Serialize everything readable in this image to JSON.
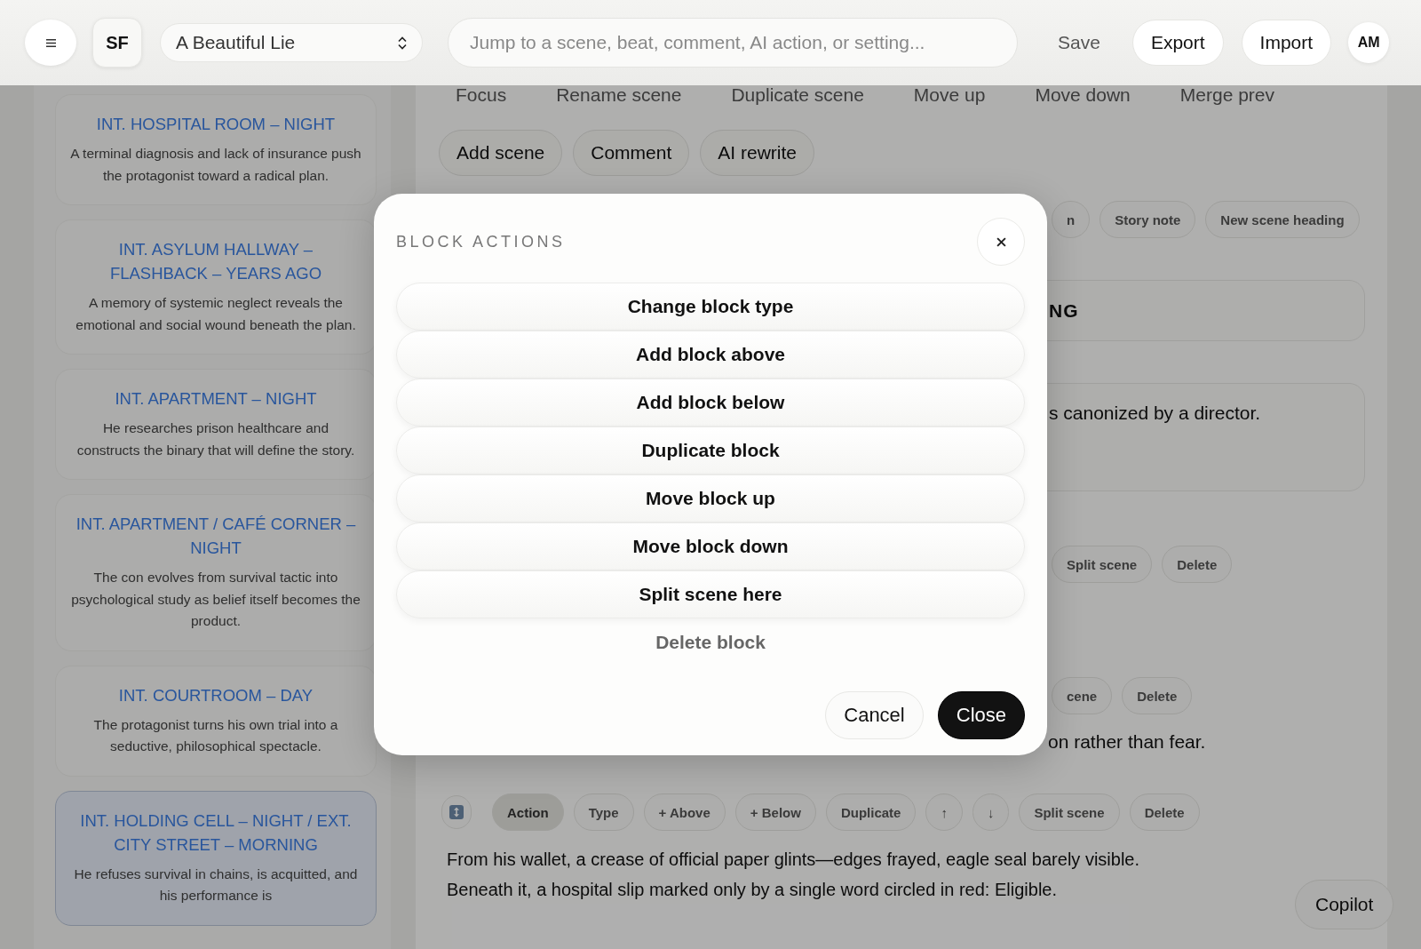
{
  "topbar": {
    "logo": "SF",
    "project": {
      "value": "A Beautiful Lie"
    },
    "search": {
      "placeholder": "Jump to a scene, beat, comment, AI action, or setting..."
    },
    "buttons": [
      {
        "label": "Save",
        "kind": "text"
      },
      {
        "label": "Export",
        "kind": "pill"
      },
      {
        "label": "Import",
        "kind": "pill"
      }
    ],
    "avatar": "AM"
  },
  "sidebar": {
    "scenes": [
      {
        "heading": "INT. HOSPITAL ROOM – NIGHT",
        "summary": "A terminal diagnosis and lack of insurance push the protagonist toward a radical plan.",
        "selected": false
      },
      {
        "heading": "INT. ASYLUM HALLWAY – FLASHBACK – YEARS AGO",
        "summary": "A memory of systemic neglect reveals the emotional and social wound beneath the plan.",
        "selected": false
      },
      {
        "heading": "INT. APARTMENT – NIGHT",
        "summary": "He researches prison healthcare and constructs the binary that will define the story.",
        "selected": false
      },
      {
        "heading": "INT. APARTMENT / CAFÉ CORNER – NIGHT",
        "summary": "The con evolves from survival tactic into psychological study as belief itself becomes the product.",
        "selected": false
      },
      {
        "heading": "INT. COURTROOM – DAY",
        "summary": "The protagonist turns his own trial into a seductive, philosophical spectacle.",
        "selected": false
      },
      {
        "heading": "INT. HOLDING CELL – NIGHT / EXT. CITY STREET – MORNING",
        "summary": "He refuses survival in chains, is acquitted, and his performance is",
        "selected": true
      }
    ]
  },
  "editor": {
    "scene_actions": [
      "Focus",
      "Rename scene",
      "Duplicate scene",
      "Move up",
      "Move down",
      "Merge prev"
    ],
    "scene_buttons": [
      "Add scene",
      "Comment",
      "AI rewrite"
    ],
    "blocks": [
      {
        "kind": "chips",
        "items": [
          {
            "label": "n",
            "selected": false
          },
          {
            "label": "Story note",
            "selected": false
          },
          {
            "label": "New scene heading",
            "selected": false
          }
        ]
      },
      {
        "kind": "heading",
        "text": "NG"
      },
      {
        "kind": "card",
        "text": "s canonized by a director."
      },
      {
        "kind": "chips",
        "items": [
          {
            "label": "Split scene",
            "selected": false
          },
          {
            "label": "Delete",
            "selected": false
          }
        ]
      },
      {
        "kind": "chips",
        "items": [
          {
            "label": "cene",
            "selected": false
          },
          {
            "label": "Delete",
            "selected": false
          }
        ]
      },
      {
        "kind": "text",
        "text": "on rather than fear."
      },
      {
        "kind": "toolbar",
        "items": [
          {
            "label": "Action",
            "selected": true
          },
          {
            "label": "Type",
            "selected": false
          },
          {
            "label": "+ Above",
            "selected": false
          },
          {
            "label": "+ Below",
            "selected": false
          },
          {
            "label": "Duplicate",
            "selected": false
          },
          {
            "label": "↑",
            "selected": false
          },
          {
            "label": "↓",
            "selected": false
          },
          {
            "label": "Split scene",
            "selected": false
          },
          {
            "label": "Delete",
            "selected": false
          }
        ]
      },
      {
        "kind": "paragraph",
        "text": "From his wallet, a crease of official paper glints—edges frayed, eagle seal barely visible. Beneath it, a hospital slip marked only by a single word circled in red: Eligible."
      }
    ]
  },
  "copilot": "Copilot",
  "modal": {
    "title": "BLOCK ACTIONS",
    "actions": [
      {
        "label": "Change block type",
        "kind": "normal"
      },
      {
        "label": "Add block above",
        "kind": "normal"
      },
      {
        "label": "Add block below",
        "kind": "normal"
      },
      {
        "label": "Duplicate block",
        "kind": "normal"
      },
      {
        "label": "Move block up",
        "kind": "normal"
      },
      {
        "label": "Move block down",
        "kind": "normal"
      },
      {
        "label": "Split scene here",
        "kind": "normal"
      },
      {
        "label": "Delete block",
        "kind": "danger"
      }
    ],
    "footer": [
      {
        "label": "Cancel",
        "kind": "secondary"
      },
      {
        "label": "Close",
        "kind": "primary"
      }
    ]
  }
}
